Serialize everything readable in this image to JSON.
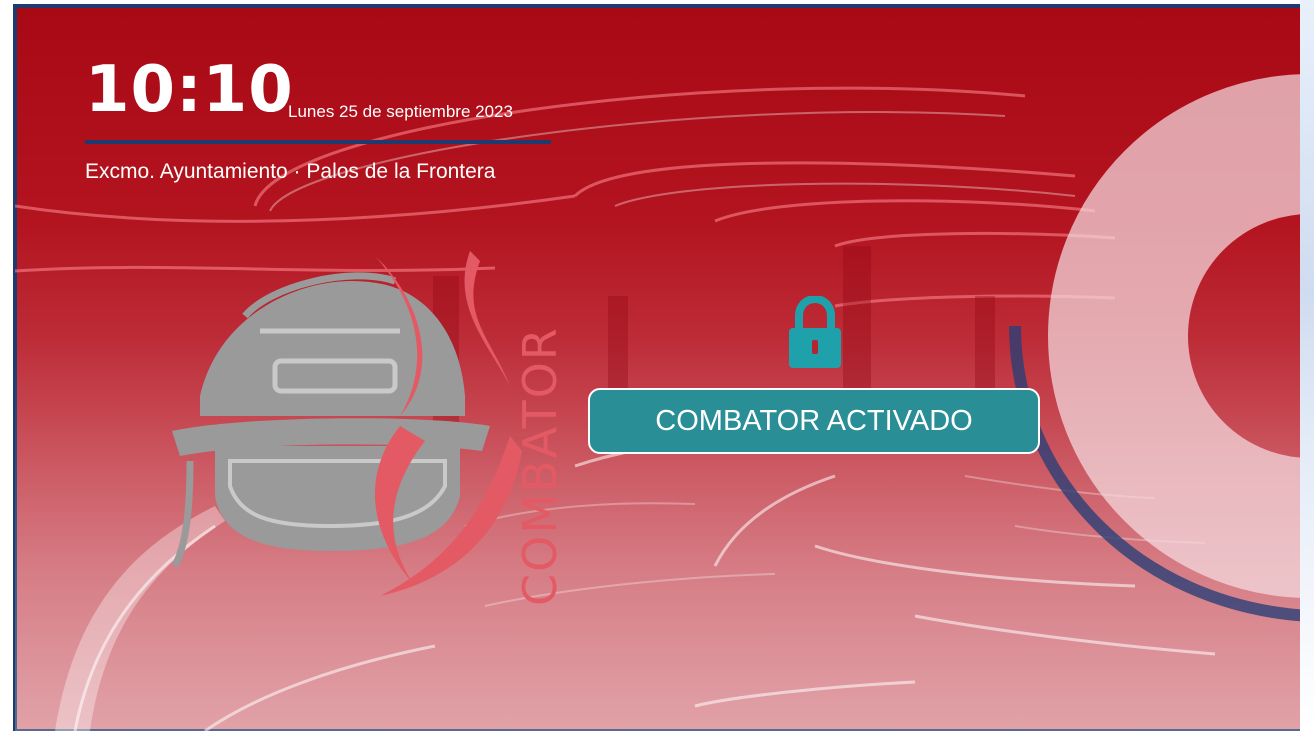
{
  "clock": {
    "time": "10:10",
    "date": "Lunes 25 de septiembre 2023"
  },
  "location": "Excmo. Ayuntamiento · Palos de la Frontera",
  "logo": {
    "wordmark": "COMBATOR",
    "icon": "firefighter-helmet-icon"
  },
  "status": {
    "label": "COMBATOR ACTIVADO",
    "icon": "padlock-icon"
  },
  "colors": {
    "background_red": "#a80914",
    "accent_teal": "#2a8e96",
    "lock_teal": "#1fa1ab",
    "navy": "#1e3a6e",
    "logo_grey": "#9a9a9a",
    "logo_red": "#e35a64"
  }
}
